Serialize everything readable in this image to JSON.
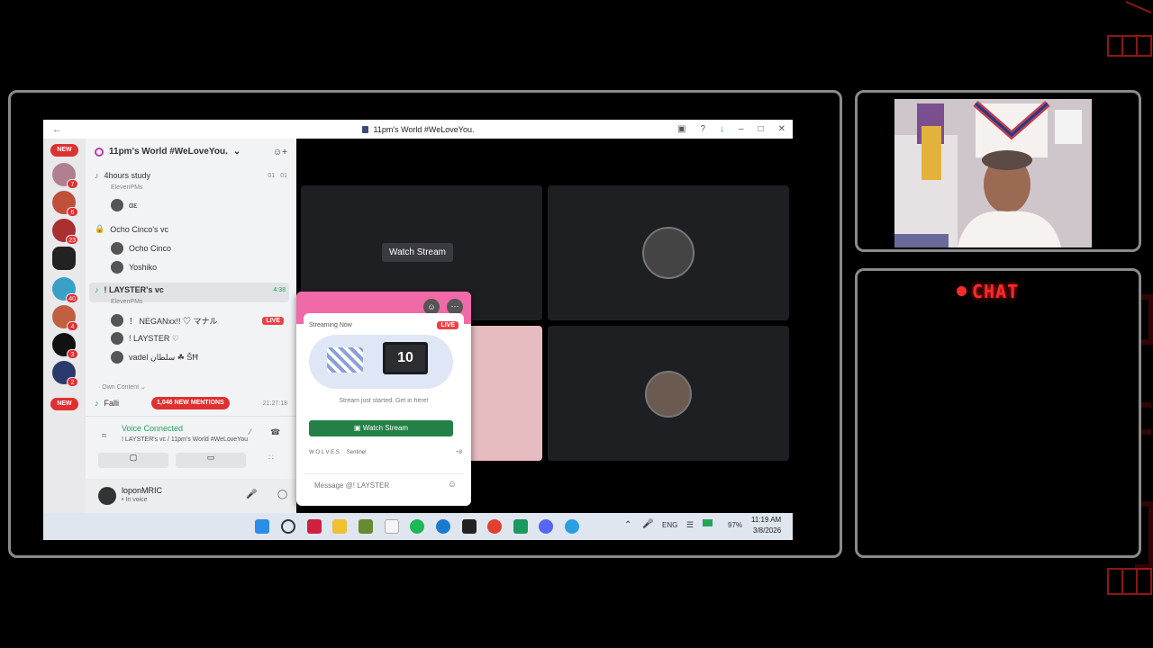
{
  "overlay": {
    "chat_label": "CHAT"
  },
  "window": {
    "title": "11pm's World #WeLoveYou."
  },
  "server": {
    "name": "11pm's World #WeLoveYou."
  },
  "server_rail": {
    "new_top": "NEW",
    "new_bottom": "NEW",
    "badges": [
      "7",
      "6",
      "23",
      "40",
      "4",
      "3",
      "2"
    ]
  },
  "channels": {
    "ch1": {
      "name": "4hours study",
      "sub": "ElevenPMs",
      "count_a": "01",
      "count_b": "01",
      "user": "αε"
    },
    "ch2": {
      "name": "Ocho Cinco's vc",
      "users": [
        "Ocho Cinco",
        "Yoshiko"
      ]
    },
    "ch3": {
      "name": "! LAYSTER's vc",
      "time": "4:38",
      "sub": "ElevenPMs",
      "users": [
        {
          "name": "！ NEGANxx!! ♡ マナル",
          "live": "LIVE"
        },
        {
          "name": "! LAYSTER ♡"
        },
        {
          "name": "vadel سلطان ☘ ŠĦ"
        }
      ]
    },
    "category": "Own Content",
    "fall_row": "Falli",
    "mentions": "1,046 NEW MENTIONS",
    "mentions_time": "21:27:18"
  },
  "voice": {
    "status": "Voice Connected",
    "detail": "! LAYSTER's vc / 11pm's World #WeLoveYou"
  },
  "user": {
    "name": "loponMRIC",
    "status": "In voice"
  },
  "stage": {
    "watch_stream": "Watch Stream"
  },
  "popup": {
    "heading": "Streaming Now",
    "live": "LIVE",
    "screen_number": "10",
    "caption": "Stream just started. Get in here!",
    "button": "Watch Stream",
    "strip_left": "W O L V E S",
    "strip_mid": "Sentinel",
    "strip_right": "+8",
    "message_placeholder": "Message @! LAYSTER"
  },
  "taskbar": {
    "lang": "ENG",
    "battery": "97%",
    "time": "11:19 AM",
    "date": "3/8/2026"
  },
  "colors": {
    "accent_green": "#23a55a",
    "live_red": "#ed4245",
    "neon_red": "#ff2a2a",
    "popup_pink": "#f06aa8"
  }
}
